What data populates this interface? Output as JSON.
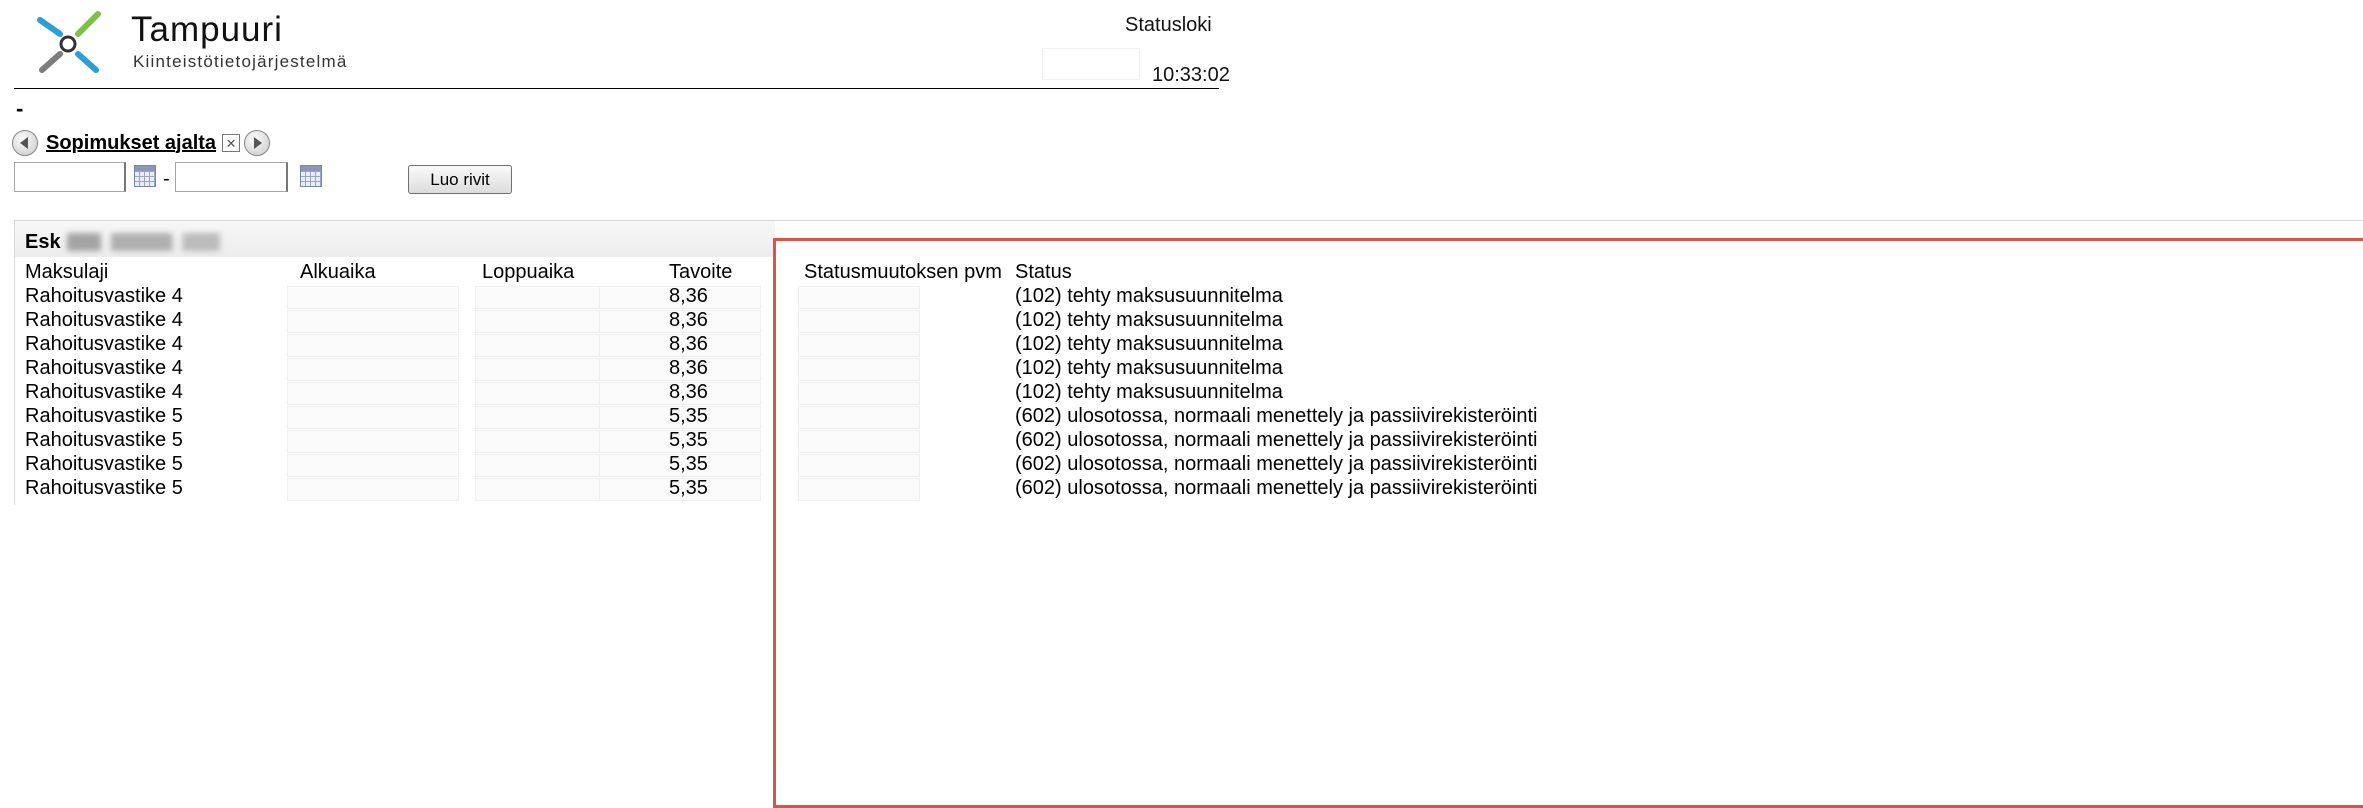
{
  "header": {
    "brand_title": "Tampuuri",
    "brand_subtitle": "Kiinteistötietojärjestelmä",
    "status_link": "Statusloki",
    "clock": "10:33:02"
  },
  "page": {
    "dash": "-"
  },
  "nav": {
    "label": "Sopimukset ajalta",
    "prev_icon": "arrow-left-icon",
    "next_icon": "arrow-right-icon",
    "clear_icon": "close-icon"
  },
  "date_range": {
    "start_value": "",
    "end_value": "",
    "separator": "-",
    "calendar_icon": "calendar-icon"
  },
  "actions": {
    "create_rows": "Luo rivit"
  },
  "table": {
    "title_prefix": "Esk",
    "headers": {
      "maksulaji": "Maksulaji",
      "alkuaika": "Alkuaika",
      "loppuaika": "Loppuaika",
      "tavoite": "Tavoite",
      "statusmuutoksen_pvm": "Statusmuutoksen pvm",
      "status": "Status"
    },
    "rows": [
      {
        "maksulaji": "Rahoitusvastike 4",
        "alkuaika": "",
        "loppuaika": "",
        "tavoite": "8,36",
        "statusmuutoksen_pvm": "",
        "status": "(102) tehty maksusuunnitelma"
      },
      {
        "maksulaji": "Rahoitusvastike 4",
        "alkuaika": "",
        "loppuaika": "",
        "tavoite": "8,36",
        "statusmuutoksen_pvm": "",
        "status": "(102) tehty maksusuunnitelma"
      },
      {
        "maksulaji": "Rahoitusvastike 4",
        "alkuaika": "",
        "loppuaika": "",
        "tavoite": "8,36",
        "statusmuutoksen_pvm": "",
        "status": "(102) tehty maksusuunnitelma"
      },
      {
        "maksulaji": "Rahoitusvastike 4",
        "alkuaika": "",
        "loppuaika": "",
        "tavoite": "8,36",
        "statusmuutoksen_pvm": "",
        "status": "(102) tehty maksusuunnitelma"
      },
      {
        "maksulaji": "Rahoitusvastike 4",
        "alkuaika": "",
        "loppuaika": "",
        "tavoite": "8,36",
        "statusmuutoksen_pvm": "",
        "status": "(102) tehty maksusuunnitelma"
      },
      {
        "maksulaji": "Rahoitusvastike 5",
        "alkuaika": "",
        "loppuaika": "",
        "tavoite": "5,35",
        "statusmuutoksen_pvm": "",
        "status": "(602) ulosotossa, normaali menettely ja passiivirekisteröinti"
      },
      {
        "maksulaji": "Rahoitusvastike 5",
        "alkuaika": "",
        "loppuaika": "",
        "tavoite": "5,35",
        "statusmuutoksen_pvm": "",
        "status": "(602) ulosotossa, normaali menettely ja passiivirekisteröinti"
      },
      {
        "maksulaji": "Rahoitusvastike 5",
        "alkuaika": "",
        "loppuaika": "",
        "tavoite": "5,35",
        "statusmuutoksen_pvm": "",
        "status": "(602) ulosotossa, normaali menettely ja passiivirekisteröinti"
      },
      {
        "maksulaji": "Rahoitusvastike 5",
        "alkuaika": "",
        "loppuaika": "",
        "tavoite": "5,35",
        "statusmuutoksen_pvm": "",
        "status": "(602) ulosotossa, normaali menettely ja passiivirekisteröinti"
      }
    ]
  },
  "colors": {
    "logo_green": "#7cc242",
    "logo_blue": "#2aa0d6",
    "logo_grey": "#7d7d7d",
    "highlight_red": "#d9534f"
  }
}
